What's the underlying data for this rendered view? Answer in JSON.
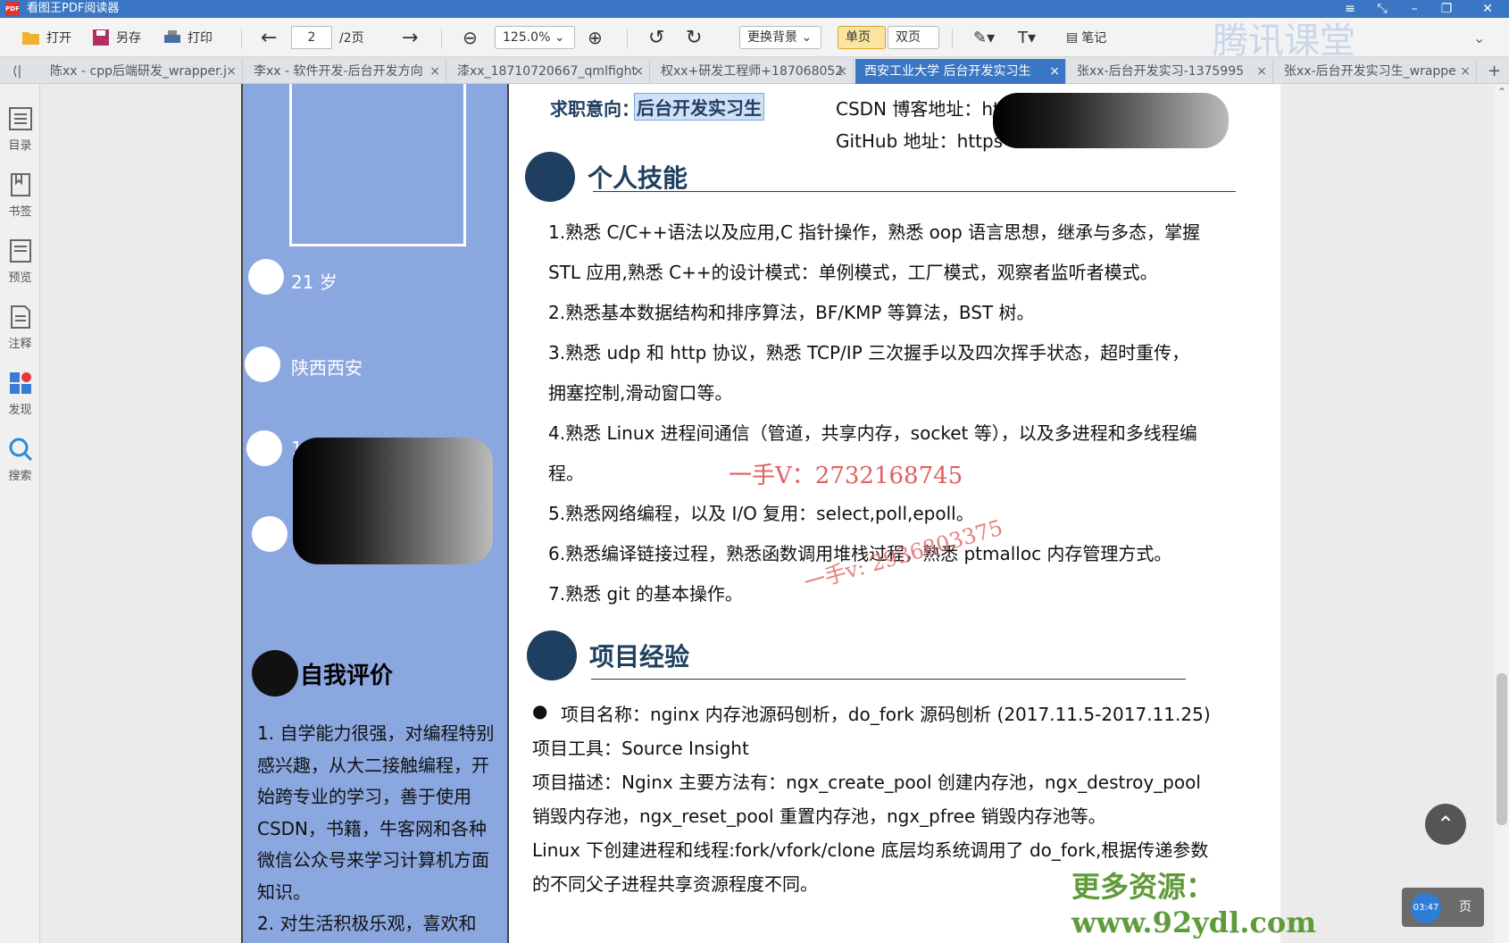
{
  "app": {
    "title": "看图王PDF阅读器",
    "logo": "PDF"
  },
  "toolbar": {
    "open": "打开",
    "saveas": "另存",
    "print": "打印",
    "page_current": "2",
    "page_total": "/2页",
    "zoom": "125.0%",
    "bg": "更换背景",
    "single": "单页",
    "double": "双页",
    "note": "笔记"
  },
  "tabs": [
    {
      "label": "陈xx - cpp后端研发_wrapper.j"
    },
    {
      "label": "李xx - 软件开发-后台开发方向"
    },
    {
      "label": "漆xx_18710720667_qmlfight"
    },
    {
      "label": "权xx+研发工程师+18706805​2"
    },
    {
      "label": "西安工业大学 后台开发实习生"
    },
    {
      "label": "张xx-后台开发实习-1375995"
    },
    {
      "label": "张xx-后台开发实习生_wrappe"
    }
  ],
  "sidebar": [
    "目录",
    "书签",
    "预览",
    "注释",
    "发现",
    "搜索"
  ],
  "left": {
    "age": "21 岁",
    "location": "陕西西安",
    "phone_prefix": "1",
    "self_title": "自我评价",
    "self_text": "1. 自学能力很强，对编程特别感兴趣，从大二接触编程，开始跨专业的学习，善于使用CSDN，书籍，牛客网和各种微信公众号来学习计算机方面知识。",
    "self_text2": "2. 对生活积极乐观，喜欢和"
  },
  "header": {
    "intent_label": "求职意向：",
    "intent_value": "后台开发实习生",
    "csdn": "CSDN 博客地址：ht",
    "github": "GitHub 地址：https"
  },
  "skills": {
    "title": "个人技能",
    "lines": [
      "1.熟悉 C/C++语法以及应用,C 指针操作，熟悉 oop 语言思想，继承与多态，掌握",
      "STL 应用,熟悉 C++的设计模式：单例模式，工厂模式，观察者监听者模式。",
      "2.熟悉基本数据结构和排序算法，BF/KMP 等算法，BST 树。",
      "3.熟悉 udp 和 http 协议，熟悉 TCP/IP 三次握手以及四次挥手状态，超时重传，",
      "拥塞控制,滑动窗口等。",
      "4.熟悉 Linux 进程间通信（管道，共享内存，socket 等），以及多进程和多线程编",
      "程。",
      "5.熟悉网络编程，以及 I/O 复用：select,poll,epoll。",
      "6.熟悉编译链接过程，熟悉函数调用堆栈过程，熟悉 ptmalloc 内存管理方式。",
      "7.熟悉 git 的基本操作。"
    ]
  },
  "project": {
    "title": "项目经验",
    "name": "项目名称：nginx 内存池源码刨析，do_fork 源码刨析 (2017.11.5-2017.11.25)",
    "tool": "项目工具：Source Insight",
    "desc1": "项目描述：Nginx 主要方法有：ngx_create_pool 创建内存池，ngx_destroy_pool",
    "desc2": "销毁内存池，ngx_reset_pool 重置内存池，ngx_pfree 销毁内存池等。",
    "desc3": "Linux 下创建进程和线程:fork/vfork/clone 底层均系统调用了 do_fork,根据传递参数",
    "desc4": "的不同父子进程共享资源程度不同。"
  },
  "watermarks": {
    "wm1": "一手V：2732168745",
    "wm2": "一手v: 2936803375",
    "wm3": "更多资源：www.92ydl.com",
    "brand": "腾讯课堂",
    "clock": "03:47",
    "page_btn": "页"
  }
}
